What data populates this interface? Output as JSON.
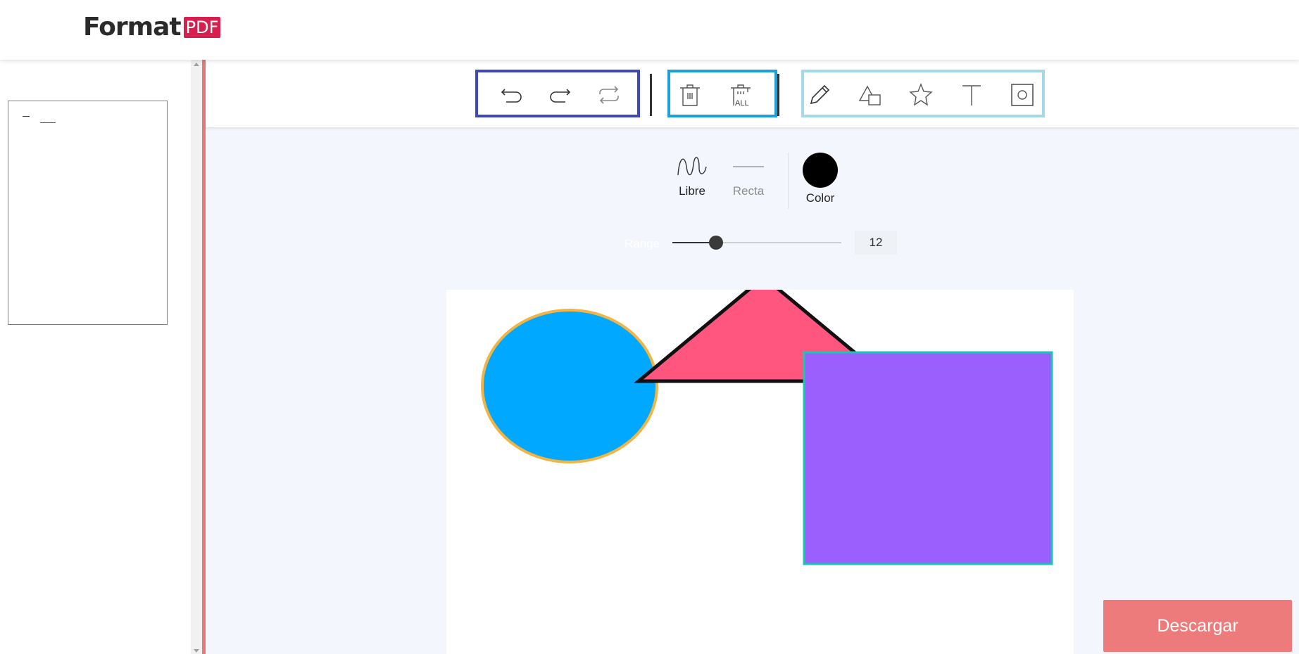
{
  "header": {
    "logo_text": "Format",
    "logo_badge": "PDF"
  },
  "sidebar": {
    "thumbnail_alt": "page-1"
  },
  "toolbar": {
    "groups": [
      {
        "name": "history",
        "color": "#3f48b8",
        "buttons": [
          "undo-icon",
          "redo-icon",
          "repeat-icon"
        ]
      },
      {
        "name": "delete",
        "color": "#1d9fda",
        "buttons": [
          "trash-icon",
          "trash-all-icon"
        ]
      },
      {
        "name": "draw",
        "color": "#a6d9e8",
        "buttons": [
          "pencil-icon",
          "shapes-icon",
          "star-icon",
          "text-icon",
          "circle-square-icon"
        ]
      }
    ],
    "trash_all_label": "ALL"
  },
  "line_options": {
    "libre_label": "Libre",
    "recta_label": "Recta",
    "color_label": "Color",
    "selected_color": "#000000"
  },
  "range": {
    "label": "Range",
    "value": "12",
    "min": 0,
    "max": 50,
    "fraction": 0.26
  },
  "canvas_shapes": [
    {
      "type": "ellipse",
      "fill": "#00a8ff",
      "stroke": "#f2b544"
    },
    {
      "type": "triangle",
      "fill": "#ff5680",
      "stroke": "#111111"
    },
    {
      "type": "rectangle",
      "fill": "#9b5ffe",
      "stroke": "#1bc7b0"
    }
  ],
  "download_label": "Descargar"
}
